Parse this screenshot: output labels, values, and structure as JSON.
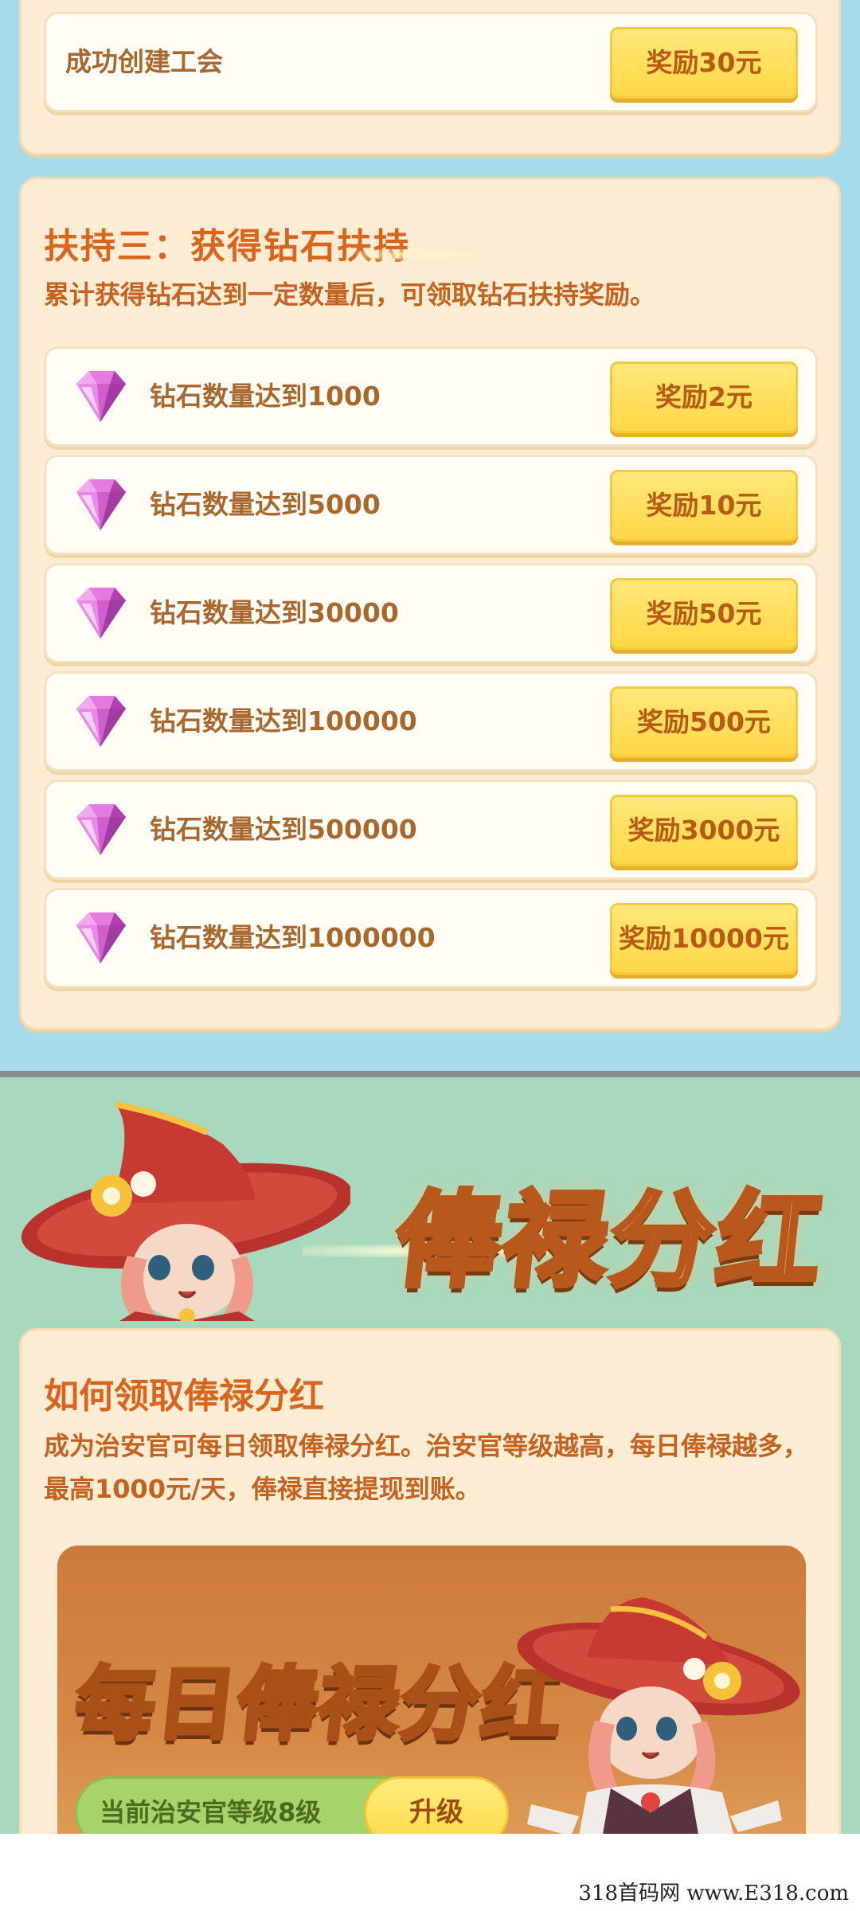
{
  "top_card": {
    "row_label": "成功创建工会",
    "reward": "奖励30元"
  },
  "diamond_section": {
    "title": "扶持三：获得钻石扶持",
    "description": "累计获得钻石达到一定数量后，可领取钻石扶持奖励。",
    "rows": [
      {
        "label": "钻石数量达到1000",
        "reward": "奖励2元",
        "icon": "gem-icon"
      },
      {
        "label": "钻石数量达到5000",
        "reward": "奖励10元",
        "icon": "gem-icon"
      },
      {
        "label": "钻石数量达到30000",
        "reward": "奖励50元",
        "icon": "gem-icon"
      },
      {
        "label": "钻石数量达到100000",
        "reward": "奖励500元",
        "icon": "gem-icon"
      },
      {
        "label": "钻石数量达到500000",
        "reward": "奖励3000元",
        "icon": "gem-icon"
      },
      {
        "label": "钻石数量达到1000000",
        "reward": "奖励10000元",
        "icon": "gem-icon"
      }
    ]
  },
  "bonus_banner": {
    "title": "俸禄分红"
  },
  "bonus_card": {
    "title": "如何领取俸禄分红",
    "description": "成为治安官可每日领取俸禄分红。治安官等级越高，每日俸禄越多，最高1000元/天，俸禄直接提现到账。",
    "panel_title": "每日俸禄分红",
    "level_text": "当前治安官等级8级",
    "upgrade_label": "升级"
  },
  "footer": {
    "watermark": "318首码网 www.E318.com"
  },
  "colors": {
    "top_bg": "#a6dcea",
    "bottom_bg": "#a8d8bd",
    "card_bg": "#fbecd3",
    "button_yellow": "#ffd747",
    "title_orange": "#d9641c"
  }
}
